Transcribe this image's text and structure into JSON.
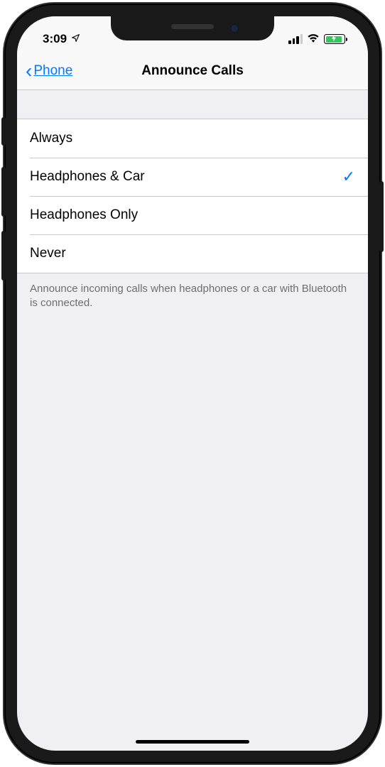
{
  "status": {
    "time": "3:09",
    "location_services": true,
    "signal_strength": 3,
    "wifi": true,
    "charging": true
  },
  "nav": {
    "back_label": "Phone",
    "title": "Announce Calls"
  },
  "options": [
    {
      "label": "Always",
      "selected": false
    },
    {
      "label": "Headphones & Car",
      "selected": true
    },
    {
      "label": "Headphones Only",
      "selected": false
    },
    {
      "label": "Never",
      "selected": false
    }
  ],
  "footer": "Announce incoming calls when headphones or a car with Bluetooth is connected."
}
